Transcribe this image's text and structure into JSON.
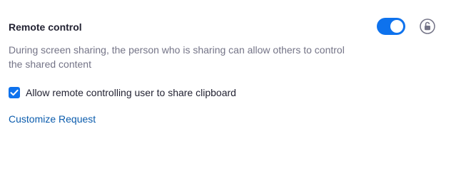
{
  "setting": {
    "title": "Remote control",
    "description": "During screen sharing, the person who is sharing can allow others to control the shared content",
    "toggle": {
      "enabled": true,
      "color": "#0e72ed"
    },
    "lock": {
      "icon": "unlocked-icon",
      "locked": false
    }
  },
  "option": {
    "label": "Allow remote controlling user to share clipboard",
    "checked": true
  },
  "link": {
    "label": "Customize Request"
  }
}
